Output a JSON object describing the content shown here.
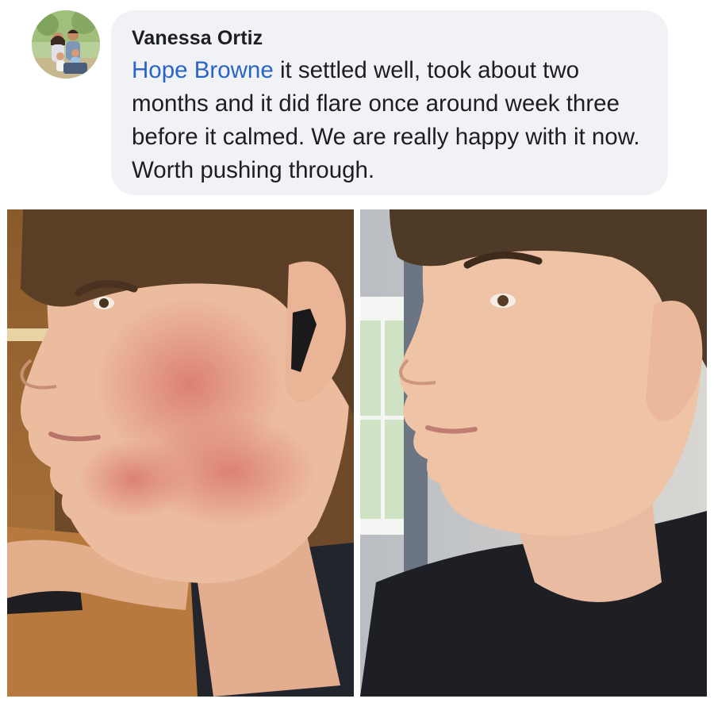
{
  "comment": {
    "author_name": "Vanessa Ortiz",
    "mention": "Hope Browne",
    "body": " it settled well, took about two months and it did flare once around week three before it calmed. We are really happy with it now. Worth pushing through."
  },
  "avatar": {
    "icon": "family-photo-avatar"
  },
  "photos": [
    {
      "icon": "before-photo-face-side-profile-rash"
    },
    {
      "icon": "after-photo-face-side-profile-clear"
    }
  ],
  "colors": {
    "bubble_bg": "#f0f2f5",
    "mention": "#2a64c4",
    "text": "#1c1e21"
  }
}
